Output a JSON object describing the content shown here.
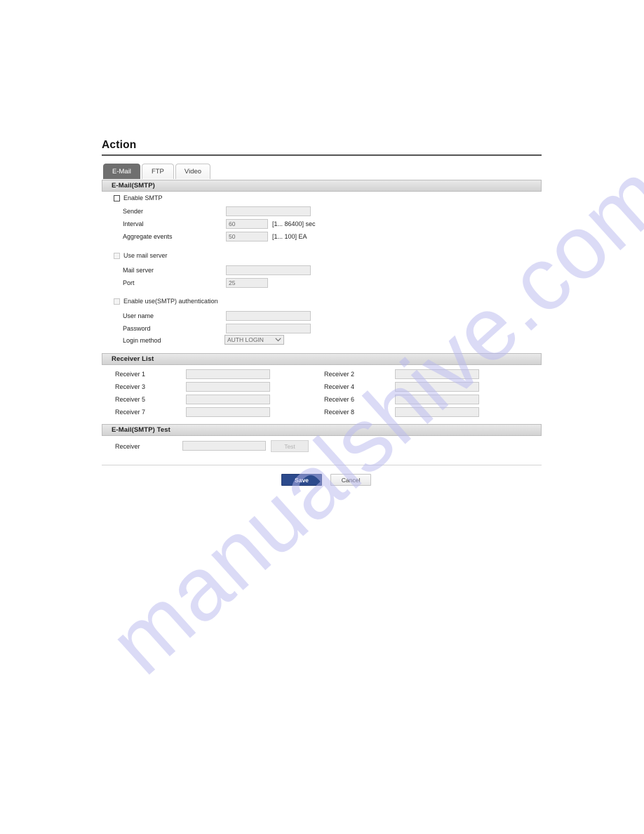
{
  "page": {
    "title": "Action"
  },
  "tabs": [
    {
      "label": "E-Mail",
      "active": true
    },
    {
      "label": "FTP",
      "active": false
    },
    {
      "label": "Video",
      "active": false
    }
  ],
  "sections": {
    "smtp": {
      "header": "E-Mail(SMTP)",
      "enable_smtp": {
        "label": "Enable SMTP",
        "checked": false,
        "enabled": true
      },
      "fields": [
        {
          "label": "Sender",
          "value": "",
          "hint": ""
        },
        {
          "label": "Interval",
          "value": "60",
          "hint": "[1... 86400] sec"
        },
        {
          "label": "Aggregate events",
          "value": "50",
          "hint": "[1... 100] EA"
        }
      ],
      "use_mail_server": {
        "label": "Use mail server",
        "checked": false,
        "enabled": false
      },
      "mail_fields": [
        {
          "label": "Mail server",
          "value": "",
          "hint": ""
        },
        {
          "label": "Port",
          "value": "25",
          "hint": ""
        }
      ],
      "enable_auth": {
        "label": "Enable use(SMTP) authentication",
        "checked": false,
        "enabled": false
      },
      "auth_fields": [
        {
          "label": "User name",
          "value": ""
        },
        {
          "label": "Password",
          "value": ""
        }
      ],
      "login_method": {
        "label": "Login method",
        "value": "AUTH LOGIN",
        "options": [
          "AUTH LOGIN"
        ],
        "chevron": "chevron-down-icon"
      }
    },
    "receiver_list": {
      "header": "Receiver List",
      "rows": [
        {
          "left_label": "Receiver 1",
          "left_value": "",
          "right_label": "Receiver 2",
          "right_value": ""
        },
        {
          "left_label": "Receiver 3",
          "left_value": "",
          "right_label": "Receiver 4",
          "right_value": ""
        },
        {
          "left_label": "Receiver 5",
          "left_value": "",
          "right_label": "Receiver 6",
          "right_value": ""
        },
        {
          "left_label": "Receiver 7",
          "left_value": "",
          "right_label": "Receiver 8",
          "right_value": ""
        }
      ]
    },
    "smtp_test": {
      "header": "E-Mail(SMTP) Test",
      "receiver_label": "Receiver",
      "receiver_value": "",
      "test_button": "Test"
    }
  },
  "actions": {
    "save": "Save",
    "cancel": "Cancel"
  },
  "watermark": {
    "text": "manualshive.com"
  },
  "colors": {
    "primary_button": "#2c4a8c",
    "active_tab": "#6f6f6f",
    "section_bar": "#d2d2d2",
    "watermark": "#b9b9ef"
  }
}
